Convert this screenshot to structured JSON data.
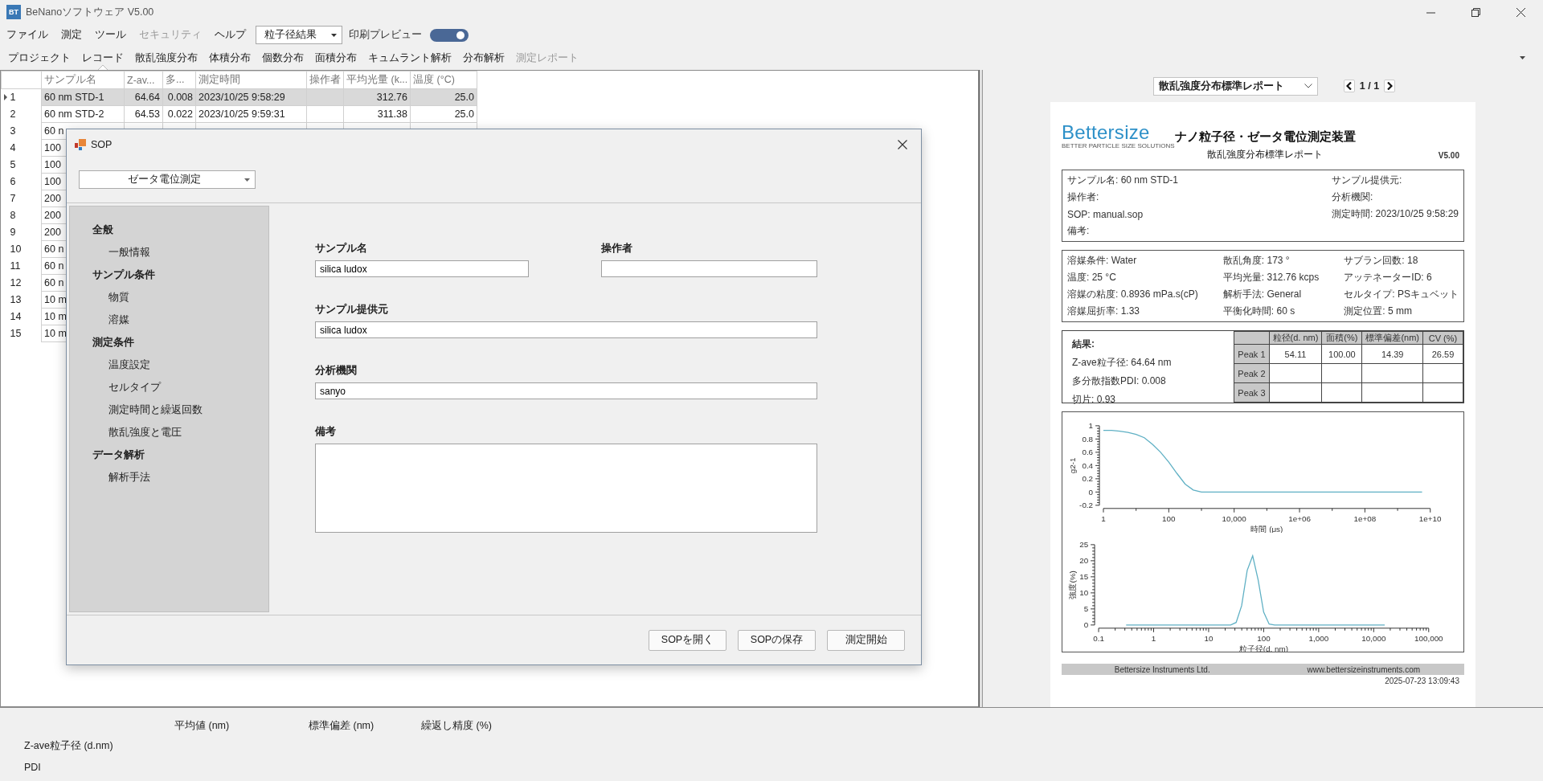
{
  "window": {
    "logo": "BT",
    "title": "BeNanoソフトウェア V5.00"
  },
  "menu": [
    {
      "label": "ファイル",
      "disabled": false
    },
    {
      "label": "測定",
      "disabled": false
    },
    {
      "label": "ツール",
      "disabled": false
    },
    {
      "label": "セキュリティ",
      "disabled": true
    },
    {
      "label": "ヘルプ",
      "disabled": false
    }
  ],
  "result_select": {
    "value": "粒子径結果"
  },
  "print_preview": {
    "label": "印刷プレビュー",
    "on": true
  },
  "tabs": [
    {
      "label": "プロジェクト",
      "selected": false,
      "disabled": false
    },
    {
      "label": "レコード",
      "selected": true,
      "disabled": false
    },
    {
      "label": "散乱強度分布",
      "selected": false,
      "disabled": false
    },
    {
      "label": "体積分布",
      "selected": false,
      "disabled": false
    },
    {
      "label": "個数分布",
      "selected": false,
      "disabled": false
    },
    {
      "label": "面積分布",
      "selected": false,
      "disabled": false
    },
    {
      "label": "キュムラント解析",
      "selected": false,
      "disabled": false
    },
    {
      "label": "分布解析",
      "selected": false,
      "disabled": false
    },
    {
      "label": "測定レポート",
      "selected": false,
      "disabled": true
    }
  ],
  "table": {
    "columns": [
      "サンプル名",
      "Z-av...",
      "多...",
      "測定時間",
      "操作者",
      "平均光量 (k...",
      "温度 (°C)"
    ],
    "rows": [
      {
        "index": "1",
        "selected": true,
        "cells": [
          "60 nm STD-1",
          "64.64",
          "0.008",
          "2023/10/25 9:58:29",
          null,
          "312.76",
          "25.0"
        ]
      },
      {
        "index": "2",
        "selected": false,
        "cells": [
          "60 nm STD-2",
          "64.53",
          "0.022",
          "2023/10/25 9:59:31",
          null,
          "311.38",
          "25.0"
        ]
      },
      {
        "index": "3",
        "selected": false,
        "cells": [
          "60 n"
        ]
      },
      {
        "index": "4",
        "selected": false,
        "cells": [
          "100"
        ]
      },
      {
        "index": "5",
        "selected": false,
        "cells": [
          "100"
        ]
      },
      {
        "index": "6",
        "selected": false,
        "cells": [
          "100"
        ]
      },
      {
        "index": "7",
        "selected": false,
        "cells": [
          "200"
        ]
      },
      {
        "index": "8",
        "selected": false,
        "cells": [
          "200"
        ]
      },
      {
        "index": "9",
        "selected": false,
        "cells": [
          "200"
        ]
      },
      {
        "index": "10",
        "selected": false,
        "cells": [
          "60 n"
        ]
      },
      {
        "index": "11",
        "selected": false,
        "cells": [
          "60 n"
        ]
      },
      {
        "index": "12",
        "selected": false,
        "cells": [
          "60 n"
        ]
      },
      {
        "index": "13",
        "selected": false,
        "cells": [
          "10 m"
        ]
      },
      {
        "index": "14",
        "selected": false,
        "cells": [
          "10 m"
        ]
      },
      {
        "index": "15",
        "selected": false,
        "cells": [
          "10 m"
        ]
      }
    ]
  },
  "sop_dialog": {
    "title": "SOP",
    "mode": "ゼータ電位測定",
    "nav": [
      {
        "label": "全般",
        "children": [
          {
            "label": "一般情報"
          }
        ]
      },
      {
        "label": "サンプル条件",
        "children": [
          {
            "label": "物質"
          },
          {
            "label": "溶媒"
          }
        ]
      },
      {
        "label": "測定条件",
        "children": [
          {
            "label": "温度設定"
          },
          {
            "label": "セルタイプ"
          },
          {
            "label": "測定時間と繰返回数"
          },
          {
            "label": "散乱強度と電圧"
          }
        ]
      },
      {
        "label": "データ解析",
        "children": [
          {
            "label": "解析手法"
          }
        ]
      }
    ],
    "fields": [
      {
        "kind": "half",
        "label": "サンプル名",
        "value": "silica ludox"
      },
      {
        "kind": "half",
        "label": "操作者"
      },
      {
        "kind": "full",
        "label": "サンプル提供元",
        "value": "silica ludox"
      },
      {
        "kind": "full",
        "label": "分析機関",
        "value": "sanyo"
      },
      {
        "kind": "multiline",
        "label": "備考"
      }
    ],
    "buttons": [
      "SOPを開く",
      "SOPの保存",
      "測定開始"
    ]
  },
  "report": {
    "template": "散乱強度分布標準レポート",
    "page": "1 / 1",
    "logo": {
      "name": "Bettersize",
      "tagline": "BETTER PARTICLE SIZE SOLUTIONS"
    },
    "title": "ナノ粒子径・ゼータ電位測定装置",
    "subtitle": "散乱強度分布標準レポート",
    "version": "V5.00",
    "sample_info": [
      "サンプル名: 60 nm STD-1",
      "サンプル提供元:",
      "操作者:",
      "分析機関:",
      "SOP: manual.sop",
      "測定時間: 2023/10/25 9:58:29",
      "備考:"
    ],
    "conditions": [
      "溶媒条件: Water",
      "散乱角度: 173 °",
      "サブラン回数: 18",
      "温度: 25 °C",
      "平均光量: 312.76 kcps",
      "アッテネーターID: 6",
      "溶媒の粘度: 0.8936 mPa.s(cP)",
      "解析手法: General",
      "セルタイプ: PSキュベット",
      "溶媒屈折率: 1.33",
      "平衡化時間: 60 s",
      "測定位置: 5 mm"
    ],
    "results": {
      "title": "結果:",
      "lines": [
        "Z-ave粒子径: 64.64 nm",
        "多分散指数PDI: 0.008",
        "切片: 0.93"
      ],
      "columns": [
        "粒径(d. nm)",
        "面積(%)",
        "標準偏差(nm)",
        "CV (%)"
      ],
      "peaks": [
        {
          "label": "Peak 1",
          "cells": [
            "54.11",
            "100.00",
            "14.39",
            "26.59"
          ]
        },
        {
          "label": "Peak 2"
        },
        {
          "label": "Peak 3"
        }
      ]
    },
    "charts": [
      {
        "chart_data": {
          "type": "line",
          "xlabel": "時間 (μs)",
          "ylabel": "g2-1",
          "categories": [
            "1",
            null,
            null,
            null,
            null,
            null,
            null,
            null,
            "100",
            null,
            null,
            null,
            null,
            null,
            null,
            null,
            "10,000",
            null,
            null,
            null,
            null,
            null,
            null,
            null,
            "1e+06",
            null,
            null,
            null,
            null,
            null,
            null,
            null,
            "1e+08",
            null,
            null,
            null,
            null,
            null,
            null,
            null,
            "1e+10"
          ],
          "series": [
            {
              "color": "#5fb0c4",
              "values": [
                0.93,
                0.93,
                0.92,
                0.9,
                0.87,
                0.82,
                0.72,
                0.6,
                0.45,
                0.28,
                0.12,
                0.03,
                0,
                0,
                0,
                0,
                0,
                0,
                0,
                0,
                0,
                0,
                0,
                0,
                0,
                0,
                0,
                0,
                0,
                0,
                0,
                0,
                0,
                0,
                0,
                0,
                0,
                0,
                0,
                0,
                null
              ]
            }
          ],
          "ylim": [
            -0.2,
            1
          ],
          "yticks": [
            -0.2,
            0,
            0.2,
            0.4,
            0.6,
            0.8,
            1
          ]
        }
      },
      {
        "chart_data": {
          "type": "line",
          "xlabel": "粒子径(d. nm)",
          "ylabel": "強度(%)",
          "categories": [
            "0.1",
            null,
            null,
            null,
            null,
            null,
            null,
            null,
            null,
            null,
            "1",
            null,
            null,
            null,
            null,
            null,
            null,
            null,
            null,
            null,
            "10",
            null,
            null,
            null,
            null,
            null,
            null,
            null,
            null,
            null,
            "100",
            null,
            null,
            null,
            null,
            null,
            null,
            null,
            null,
            null,
            "1,000",
            null,
            null,
            null,
            null,
            null,
            null,
            null,
            null,
            null,
            "10,000",
            null,
            null,
            null,
            null,
            null,
            null,
            null,
            null,
            null,
            "100,000"
          ],
          "series": [
            {
              "color": "#5fb0c4",
              "values": [
                null,
                null,
                null,
                null,
                null,
                0,
                0,
                0,
                0,
                0,
                0,
                0,
                0,
                0,
                0,
                0,
                0,
                0,
                0,
                0,
                0,
                0,
                0,
                0,
                0,
                0.8,
                6,
                17,
                21.5,
                14,
                4,
                0.3,
                0,
                0,
                0,
                0,
                0,
                0,
                0,
                0,
                0,
                0,
                0,
                0,
                0,
                0,
                0,
                0,
                0,
                0,
                0,
                0,
                0,
                null,
                null,
                null,
                null,
                null,
                null,
                null,
                null
              ]
            }
          ],
          "ylim": [
            0,
            25
          ],
          "yticks": [
            0,
            5,
            10,
            15,
            20,
            25
          ]
        }
      }
    ],
    "footer": {
      "company": "Bettersize Instruments Ltd.",
      "website": "www.bettersizeinstruments.com",
      "printed": "2025-07-23 13:09:43"
    }
  },
  "summary": {
    "columns": [
      "平均値 (nm)",
      "標準偏差 (nm)",
      "繰返し精度 (%)"
    ],
    "rows": [
      "Z-ave粒子径 (d.nm)",
      "PDI"
    ]
  }
}
